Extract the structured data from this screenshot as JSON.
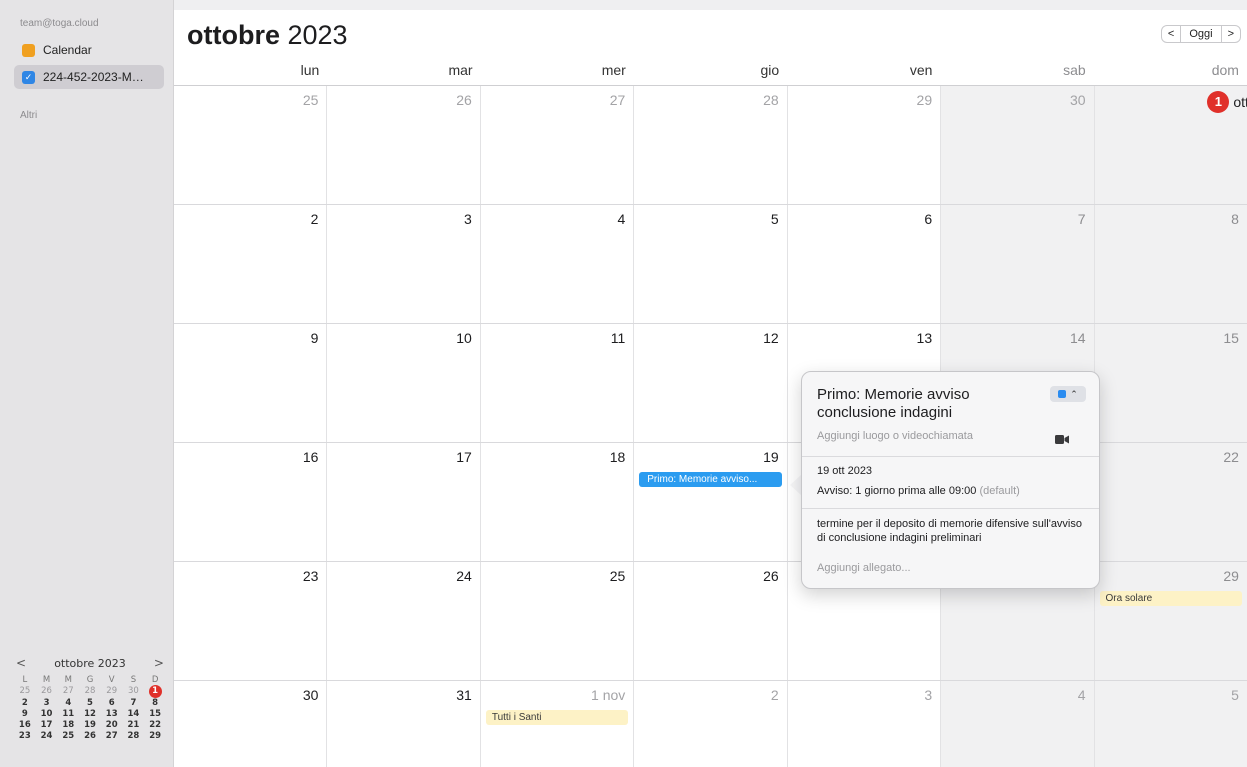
{
  "sidebar": {
    "account": "team@toga.cloud",
    "calendars": [
      {
        "label": "Calendar",
        "checked": false,
        "color": "#f0a020"
      },
      {
        "label": "224-452-2023-M…",
        "checked": true,
        "color": "#2f86e5"
      }
    ],
    "others_label": "Altri",
    "mini": {
      "title": "ottobre 2023",
      "prev": "<",
      "next": ">",
      "weekdays": [
        "L",
        "M",
        "M",
        "G",
        "V",
        "S",
        "D"
      ],
      "weeks": [
        [
          "25",
          "26",
          "27",
          "28",
          "29",
          "30",
          "1"
        ],
        [
          "2",
          "3",
          "4",
          "5",
          "6",
          "7",
          "8"
        ],
        [
          "9",
          "10",
          "11",
          "12",
          "13",
          "14",
          "15"
        ],
        [
          "16",
          "17",
          "18",
          "19",
          "20",
          "21",
          "22"
        ],
        [
          "23",
          "24",
          "25",
          "26",
          "27",
          "28",
          "29"
        ]
      ]
    }
  },
  "header": {
    "month": "ottobre",
    "year": "2023",
    "prev": "<",
    "today": "Oggi",
    "next": ">"
  },
  "weekdays": [
    "lun",
    "mar",
    "mer",
    "gio",
    "ven",
    "sab",
    "dom"
  ],
  "weeks": [
    [
      "25",
      "26",
      "27",
      "28",
      "29",
      "30",
      "ott"
    ],
    [
      "2",
      "3",
      "4",
      "5",
      "6",
      "7",
      "8"
    ],
    [
      "9",
      "10",
      "11",
      "12",
      "13",
      "14",
      "15"
    ],
    [
      "16",
      "17",
      "18",
      "19",
      "",
      "",
      "22"
    ],
    [
      "23",
      "24",
      "25",
      "26",
      "",
      "",
      "29"
    ],
    [
      "30",
      "31",
      "1 nov",
      "2",
      "3",
      "4",
      "5"
    ]
  ],
  "today_number": "1",
  "events": {
    "primo": "Primo: Memorie avviso...",
    "ora_solare": "Ora solare",
    "tutti_santi": "Tutti i Santi"
  },
  "popover": {
    "title": "Primo: Memorie avviso conclusione indagini",
    "location_placeholder": "Aggiungi luogo o videochiamata",
    "date": "19 ott 2023",
    "alert": "Avviso: 1 giorno prima alle 09:00",
    "alert_default": "(default)",
    "notes": "termine per il deposito di memorie difensive sull'avviso di conclusione indagini preliminari",
    "attachment_placeholder": "Aggiungi allegato...",
    "color": "#2b8cf0"
  }
}
